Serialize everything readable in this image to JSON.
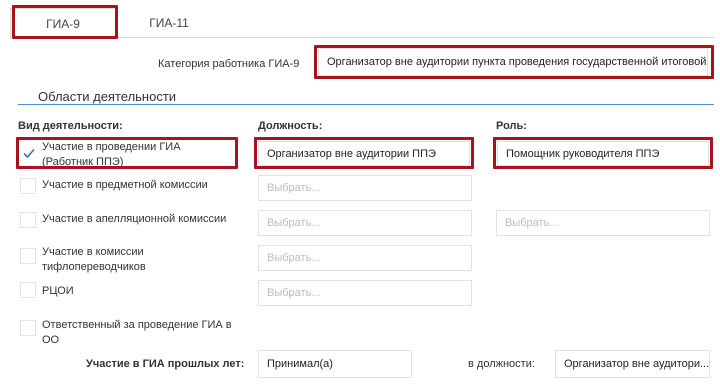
{
  "tabs": [
    {
      "label": "ГИА-9"
    },
    {
      "label": "ГИА-11"
    }
  ],
  "category": {
    "label": "Категория работника ГИА-9",
    "value": "Организатор вне аудитории пункта проведения государственной итоговой..."
  },
  "section_title": "Области деятельности",
  "columns": {
    "activity": "Вид деятельности:",
    "position": "Должность:",
    "role": "Роль:"
  },
  "rows": [
    {
      "activity": "Участие в проведении ГИА (Работник ППЭ)",
      "checked": true,
      "position": "Организатор вне аудитории ППЭ",
      "role": "Помощник руководителя ППЭ"
    },
    {
      "activity": "Участие в предметной комиссии",
      "checked": false,
      "position_placeholder": "Выбрать..."
    },
    {
      "activity": "Участие в апелляционной комиссии",
      "checked": false,
      "position_placeholder": "Выбрать...",
      "role_placeholder": "Выбрать..."
    },
    {
      "activity": "Участие в комиссии тифлопереводчиков",
      "checked": false,
      "position_placeholder": "Выбрать..."
    },
    {
      "activity": "РЦОИ",
      "checked": false,
      "position_placeholder": "Выбрать..."
    },
    {
      "activity": "Ответственный за проведение ГИА в ОО",
      "checked": false
    }
  ],
  "past": {
    "label": "Участие в ГИА прошлых лет:",
    "value": "Принимал(а)",
    "position_label": "в должности:",
    "position_value": "Организатор вне аудитори..."
  },
  "colors": {
    "highlight": "#a6141e",
    "accent_line": "#4a90d9",
    "check": "#3b6fb6"
  }
}
